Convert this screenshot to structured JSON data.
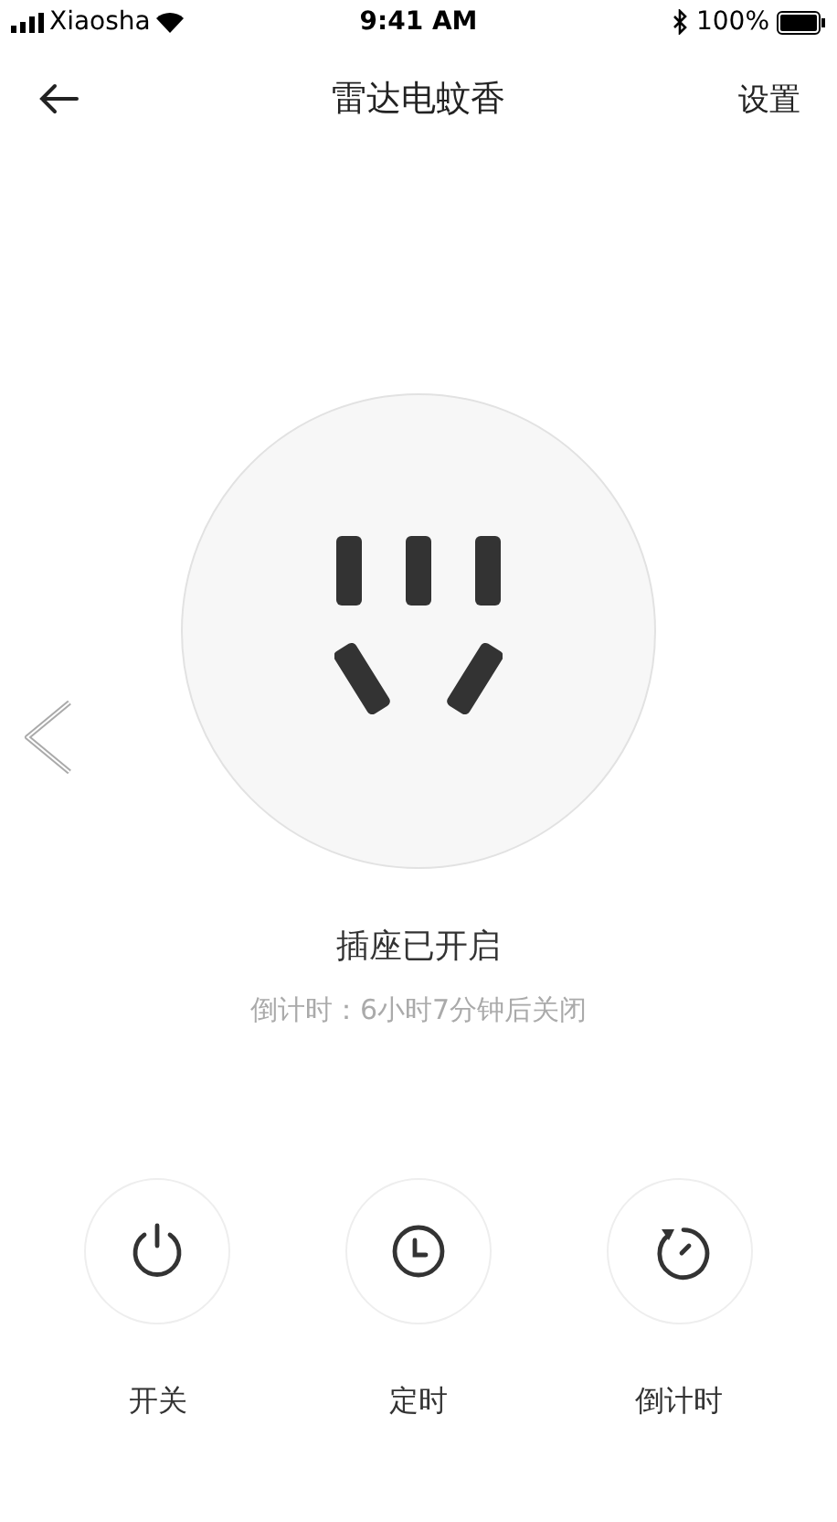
{
  "status_bar": {
    "carrier": "Xiaosha",
    "time": "9:41 AM",
    "battery": "100%"
  },
  "nav": {
    "title": "雷达电蚊香",
    "action": "设置"
  },
  "device": {
    "status": "插座已开启",
    "countdown": "倒计时：6小时7分钟后关闭"
  },
  "actions": [
    {
      "kind": "power",
      "label": "开关"
    },
    {
      "kind": "schedule",
      "label": "定时"
    },
    {
      "kind": "countdown",
      "label": "倒计时"
    }
  ]
}
